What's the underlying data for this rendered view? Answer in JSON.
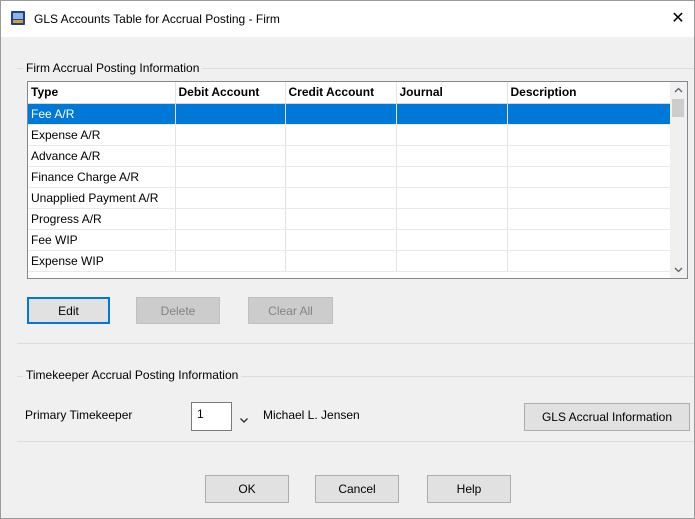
{
  "window": {
    "title": "GLS Accounts Table for Accrual Posting - Firm",
    "close_glyph": "✕"
  },
  "firm_section": {
    "label": "Firm Accrual Posting Information",
    "columns": [
      "Type",
      "Debit Account",
      "Credit Account",
      "Journal",
      "Description"
    ],
    "rows": [
      {
        "type": "Fee A/R",
        "debit": "",
        "credit": "",
        "journal": "",
        "description": ""
      },
      {
        "type": "Expense A/R",
        "debit": "",
        "credit": "",
        "journal": "",
        "description": ""
      },
      {
        "type": "Advance A/R",
        "debit": "",
        "credit": "",
        "journal": "",
        "description": ""
      },
      {
        "type": "Finance Charge A/R",
        "debit": "",
        "credit": "",
        "journal": "",
        "description": ""
      },
      {
        "type": "Unapplied Payment A/R",
        "debit": "",
        "credit": "",
        "journal": "",
        "description": ""
      },
      {
        "type": "Progress A/R",
        "debit": "",
        "credit": "",
        "journal": "",
        "description": ""
      },
      {
        "type": "Fee WIP",
        "debit": "",
        "credit": "",
        "journal": "",
        "description": ""
      },
      {
        "type": "Expense WIP",
        "debit": "",
        "credit": "",
        "journal": "",
        "description": ""
      }
    ],
    "selected_row": 0,
    "buttons": {
      "edit": "Edit",
      "delete": "Delete",
      "clear_all": "Clear All"
    }
  },
  "timekeeper_section": {
    "label": "Timekeeper Accrual Posting Information",
    "primary_label": "Primary Timekeeper",
    "primary_value": "1",
    "primary_name": "Michael L. Jensen",
    "gls_button": "GLS Accrual Information"
  },
  "footer": {
    "ok": "OK",
    "cancel": "Cancel",
    "help": "Help"
  },
  "icons": {
    "app": "app-icon",
    "dropdown": "chevron-down-icon",
    "scroll_up": "scroll-up-arrow-icon",
    "scroll_down": "scroll-down-arrow-icon"
  },
  "colors": {
    "selection": "#0078d7",
    "default_button_border": "#0078d7",
    "dialog_bg": "#f0f0f0"
  }
}
